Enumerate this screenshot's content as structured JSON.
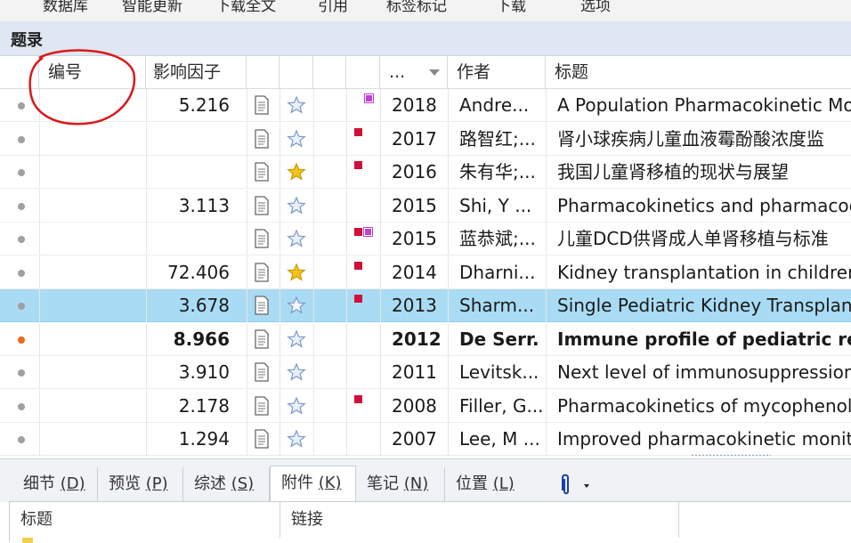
{
  "menu": [
    "数据库",
    "智能更新",
    "下载全文",
    "引用",
    "标签标记",
    "下载",
    "选项"
  ],
  "panel_title": "题录",
  "columns": {
    "number": "编号",
    "impact": "影响因子",
    "year": "...",
    "author": "作者",
    "title": "标题"
  },
  "rows": [
    {
      "impact": "5.216",
      "starred": false,
      "tags": [
        "purple"
      ],
      "year": "2018",
      "author": "Andre...",
      "title": "A Population Pharmacokinetic Mo",
      "unread": false,
      "selected": false
    },
    {
      "impact": "",
      "starred": false,
      "tags": [
        "red"
      ],
      "year": "2017",
      "author": "路智红;...",
      "title": "肾小球疾病儿童血液霉酚酸浓度监",
      "unread": false,
      "selected": false
    },
    {
      "impact": "",
      "starred": true,
      "tags": [
        "red"
      ],
      "year": "2016",
      "author": "朱有华;...",
      "title": "我国儿童肾移植的现状与展望",
      "unread": false,
      "selected": false
    },
    {
      "impact": "3.113",
      "starred": false,
      "tags": [],
      "year": "2015",
      "author": "Shi, Y ...",
      "title": "Pharmacokinetics and pharmacod",
      "unread": false,
      "selected": false
    },
    {
      "impact": "",
      "starred": false,
      "tags": [
        "red",
        "purple"
      ],
      "year": "2015",
      "author": "蓝恭斌;...",
      "title": "儿童DCD供肾成人单肾移植与标准",
      "unread": false,
      "selected": false
    },
    {
      "impact": "72.406",
      "starred": true,
      "tags": [
        "red"
      ],
      "year": "2014",
      "author": "Dharni...",
      "title": "Kidney transplantation in children",
      "unread": false,
      "selected": false
    },
    {
      "impact": "3.678",
      "starred": false,
      "tags": [
        "red"
      ],
      "year": "2013",
      "author": "Sharm...",
      "title": "Single Pediatric Kidney Transplant",
      "unread": false,
      "selected": true
    },
    {
      "impact": "8.966",
      "starred": false,
      "tags": [],
      "year": "2012",
      "author": "De Serr.",
      "title": "Immune profile of pediatric re",
      "unread": true,
      "selected": false
    },
    {
      "impact": "3.910",
      "starred": false,
      "tags": [],
      "year": "2011",
      "author": "Levitsk...",
      "title": "Next level of immunosuppression",
      "unread": false,
      "selected": false
    },
    {
      "impact": "2.178",
      "starred": false,
      "tags": [
        "red"
      ],
      "year": "2008",
      "author": "Filler, G...",
      "title": "Pharmacokinetics of mycophenol",
      "unread": false,
      "selected": false
    },
    {
      "impact": "1.294",
      "starred": false,
      "tags": [],
      "year": "2007",
      "author": "Lee, M ...",
      "title": "Improved pharmacokinetic monit",
      "unread": false,
      "selected": false
    }
  ],
  "tabs": [
    {
      "label": "细节",
      "key": "(D)"
    },
    {
      "label": "预览",
      "key": "(P)"
    },
    {
      "label": "综述",
      "key": "(S)"
    },
    {
      "label": "附件",
      "key": "(K)"
    },
    {
      "label": "笔记",
      "key": "(N)"
    },
    {
      "label": "位置",
      "key": "(L)"
    }
  ],
  "detail_columns": [
    "标题",
    "链接"
  ],
  "colors": {
    "selected_row": "#a9dcf4",
    "tag_red": "#d0103a",
    "tag_purple": "#c040d0",
    "unread_dot": "#ee6a1a",
    "read_dot": "#a0a0a0",
    "annotation": "#d81b1b",
    "star_gold": "#f2c21b"
  },
  "icons": [
    "document-icon",
    "star-icon",
    "attachment-icon",
    "dropdown-arrow-icon"
  ]
}
